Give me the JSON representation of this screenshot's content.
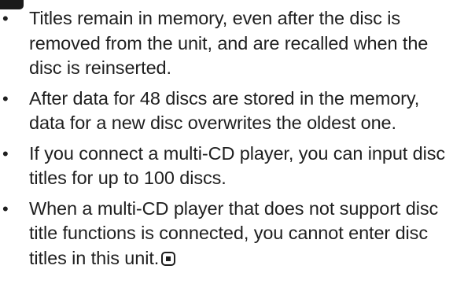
{
  "notes": {
    "items": [
      {
        "bullet": "•",
        "text": "Titles remain in memory, even after the disc is removed from the unit, and are recalled when the disc is reinserted."
      },
      {
        "bullet": "•",
        "text": "After data for 48 discs are stored in the mem­ory, data for a new disc overwrites the oldest one."
      },
      {
        "bullet": "•",
        "text": "If you connect a multi-CD player, you can input disc titles for up to 100 discs."
      },
      {
        "bullet": "•",
        "text": "When a multi-CD player that does not support disc title functions is connected, you cannot enter disc titles in this unit."
      }
    ],
    "end_icon": "end-of-section-icon"
  }
}
